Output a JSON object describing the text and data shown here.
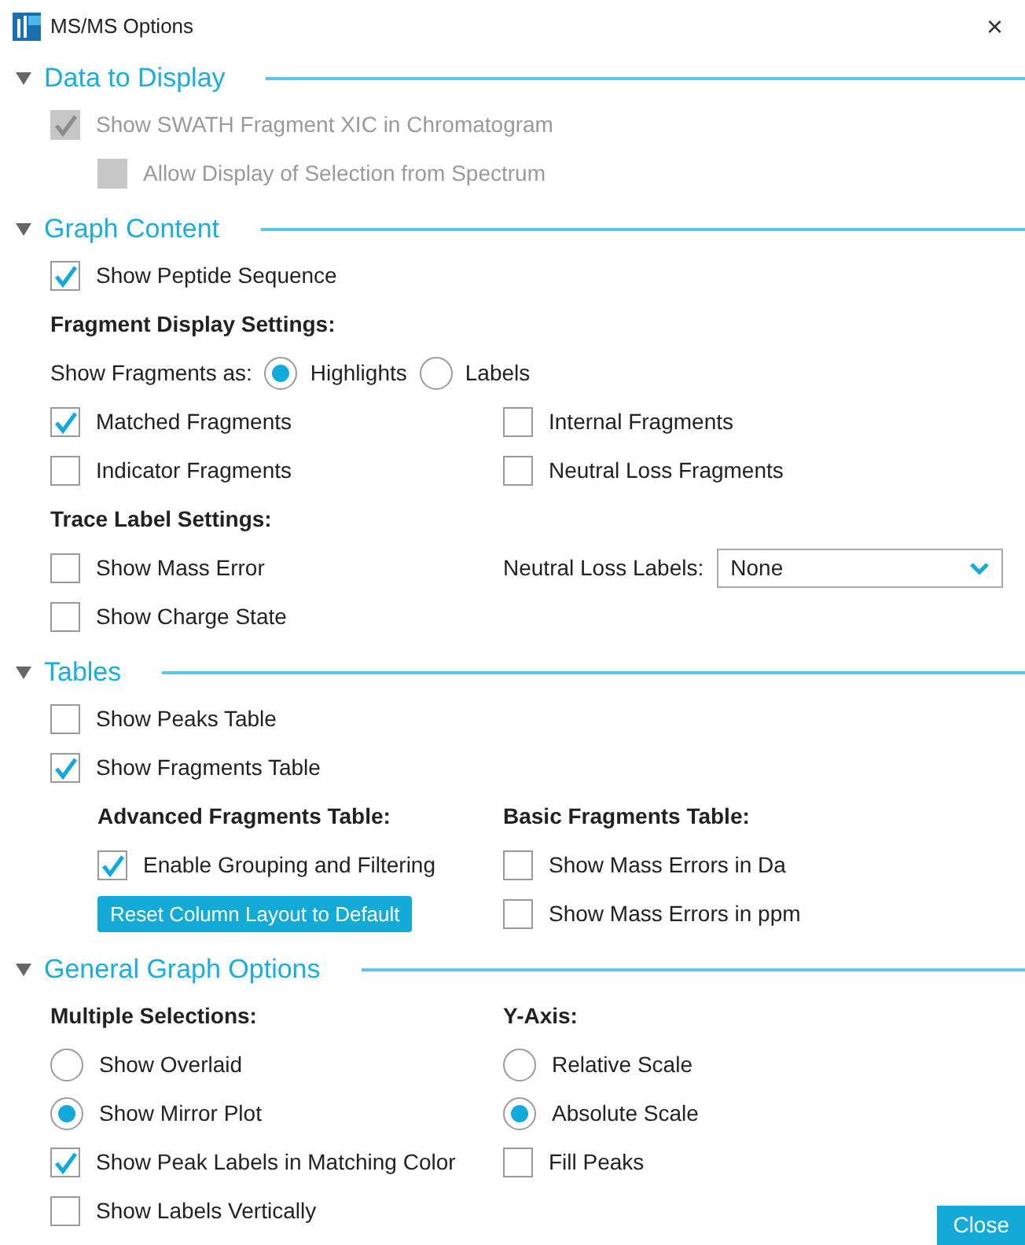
{
  "window": {
    "title": "MS/MS Options",
    "close": "×"
  },
  "sections": [
    {
      "title": "Data to Display",
      "expanded": true,
      "rows": [
        {
          "left": {
            "kind": "checkbox",
            "label": "Show SWATH Fragment XIC in Chromatogram",
            "checked": true,
            "disabled": true,
            "children": [
              {
                "left": {
                  "kind": "checkbox",
                  "label": "Allow Display of Selection from Spectrum",
                  "checked": false,
                  "disabled": true
                }
              }
            ]
          }
        }
      ]
    },
    {
      "title": "Graph Content",
      "expanded": true,
      "rows": [
        {
          "left": {
            "kind": "checkbox",
            "label": "Show Peptide Sequence",
            "checked": true,
            "disabled": false
          }
        },
        {
          "left": {
            "kind": "heading",
            "label": "Fragment Display Settings:"
          }
        },
        {
          "left": {
            "kind": "radio-group",
            "label": "Show Fragments as:",
            "options": [
              {
                "label": "Highlights",
                "selected": true
              },
              {
                "label": "Labels",
                "selected": false
              }
            ]
          }
        },
        {
          "left": {
            "kind": "checkbox",
            "label": "Matched Fragments",
            "checked": true,
            "disabled": false
          },
          "right": {
            "kind": "checkbox",
            "label": "Internal Fragments",
            "checked": false,
            "disabled": false
          }
        },
        {
          "left": {
            "kind": "checkbox",
            "label": "Indicator Fragments",
            "checked": false,
            "disabled": false
          },
          "right": {
            "kind": "checkbox",
            "label": "Neutral Loss Fragments",
            "checked": false,
            "disabled": false
          }
        },
        {
          "left": {
            "kind": "heading",
            "label": "Trace Label Settings:"
          }
        },
        {
          "left": {
            "kind": "checkbox",
            "label": "Show Mass Error",
            "checked": false,
            "disabled": false
          },
          "right": {
            "kind": "dropdown",
            "label": "Neutral Loss Labels:",
            "value": "None"
          }
        },
        {
          "left": {
            "kind": "checkbox",
            "label": "Show Charge State",
            "checked": false,
            "disabled": false
          }
        }
      ]
    },
    {
      "title": "Tables",
      "expanded": true,
      "rows": [
        {
          "left": {
            "kind": "checkbox",
            "label": "Show Peaks Table",
            "checked": false,
            "disabled": false
          }
        },
        {
          "left": {
            "kind": "checkbox",
            "label": "Show Fragments Table",
            "checked": true,
            "disabled": false,
            "children": [
              {
                "left": {
                  "kind": "heading",
                  "label": "Advanced Fragments Table:"
                },
                "right": {
                  "kind": "heading",
                  "label": "Basic Fragments Table:"
                }
              },
              {
                "left": {
                  "kind": "checkbox",
                  "label": "Enable Grouping and Filtering",
                  "checked": true,
                  "disabled": false
                },
                "right": {
                  "kind": "checkbox",
                  "label": "Show Mass Errors in Da",
                  "checked": false,
                  "disabled": false
                }
              },
              {
                "left": {
                  "kind": "button",
                  "label": "Reset Column Layout to Default"
                },
                "right": {
                  "kind": "checkbox",
                  "label": "Show Mass Errors in ppm",
                  "checked": false,
                  "disabled": false
                }
              }
            ]
          }
        }
      ]
    },
    {
      "title": "General Graph Options",
      "expanded": true,
      "rows": [
        {
          "left": {
            "kind": "heading",
            "label": "Multiple Selections:"
          },
          "right": {
            "kind": "heading",
            "label": "Y-Axis:"
          }
        },
        {
          "left": {
            "kind": "radio",
            "label": "Show Overlaid",
            "selected": false
          },
          "right": {
            "kind": "radio",
            "label": "Relative Scale",
            "selected": false
          }
        },
        {
          "left": {
            "kind": "radio",
            "label": "Show Mirror Plot",
            "selected": true
          },
          "right": {
            "kind": "radio",
            "label": "Absolute Scale",
            "selected": true
          }
        },
        {
          "left": {
            "kind": "checkbox",
            "label": "Show Peak Labels in Matching Color",
            "checked": true,
            "disabled": false
          },
          "right": {
            "kind": "checkbox",
            "label": "Fill Peaks",
            "checked": false,
            "disabled": false
          }
        },
        {
          "left": {
            "kind": "checkbox",
            "label": "Show Labels Vertically",
            "checked": false,
            "disabled": false
          }
        }
      ]
    }
  ],
  "footer": {
    "button": "Close"
  }
}
